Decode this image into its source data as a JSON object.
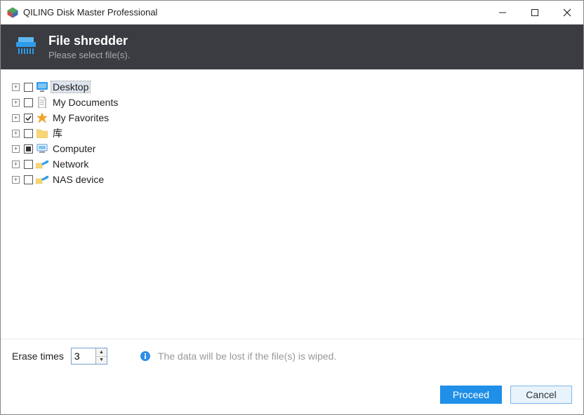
{
  "title": "QILING Disk Master Professional",
  "header": {
    "title": "File shredder",
    "subtitle": "Please select file(s)."
  },
  "tree": {
    "nodes": [
      {
        "label": "Desktop",
        "check": "unchecked",
        "selected": true,
        "icon": "desktop"
      },
      {
        "label": "My Documents",
        "check": "unchecked",
        "selected": false,
        "icon": "document"
      },
      {
        "label": "My Favorites",
        "check": "checked",
        "selected": false,
        "icon": "star"
      },
      {
        "label": "库",
        "check": "unchecked",
        "selected": false,
        "icon": "folder"
      },
      {
        "label": "Computer",
        "check": "partial",
        "selected": false,
        "icon": "computer"
      },
      {
        "label": "Network",
        "check": "unchecked",
        "selected": false,
        "icon": "network"
      },
      {
        "label": "NAS device",
        "check": "unchecked",
        "selected": false,
        "icon": "network"
      }
    ]
  },
  "footer": {
    "erase_label": "Erase times",
    "erase_value": "3",
    "info_text": "The data will be lost if the file(s) is wiped.",
    "proceed": "Proceed",
    "cancel": "Cancel"
  }
}
